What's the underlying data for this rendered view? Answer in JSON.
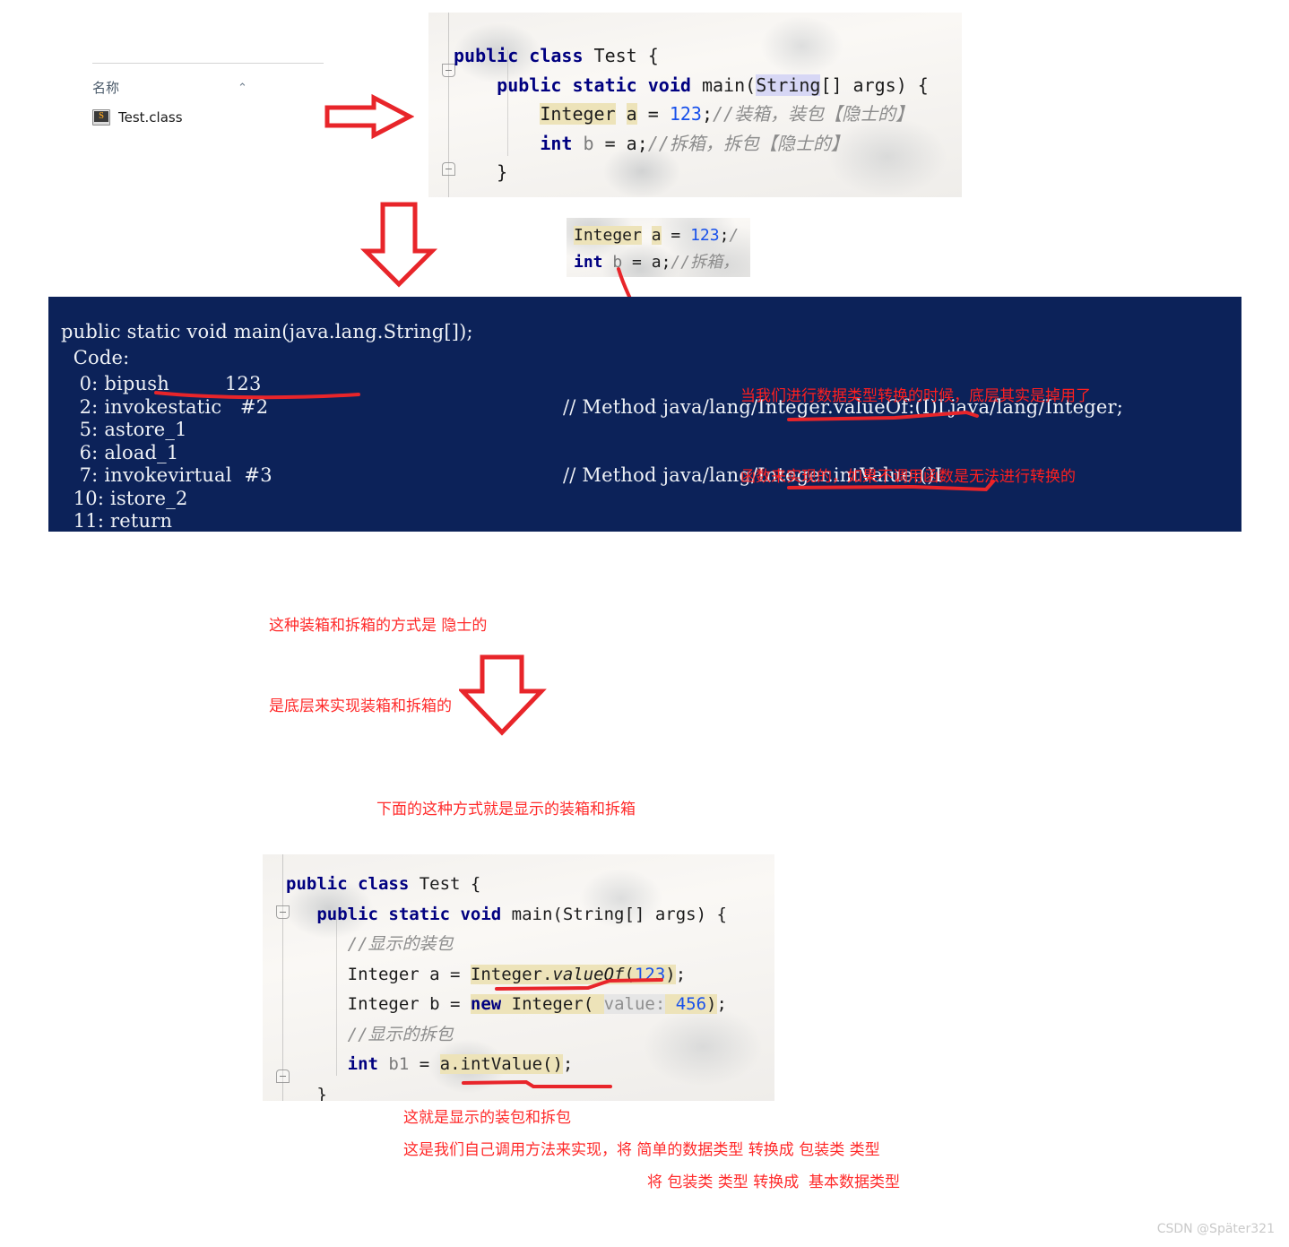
{
  "explorer": {
    "column_header": "名称",
    "sort_caret": "⌃",
    "file_name": "Test.class",
    "file_icon": "java-class-file-icon"
  },
  "top_editor": {
    "lines": [
      {
        "tokens": [
          {
            "t": "public ",
            "c": "kw"
          },
          {
            "t": "class ",
            "c": "kw"
          },
          {
            "t": "Test {",
            "c": "plain"
          }
        ]
      },
      {
        "tokens": [
          {
            "t": "    public ",
            "c": "kw"
          },
          {
            "t": "static ",
            "c": "kw"
          },
          {
            "t": "void ",
            "c": "kw"
          },
          {
            "t": "main(",
            "c": "plain"
          },
          {
            "t": "String",
            "c": "plain hlp"
          },
          {
            "t": "[] args) {",
            "c": "plain"
          }
        ]
      },
      {
        "tokens": [
          {
            "t": "        ",
            "c": "plain"
          },
          {
            "t": "Integer",
            "c": "plain hl"
          },
          {
            "t": " ",
            "c": "plain"
          },
          {
            "t": "a",
            "c": "plain hl"
          },
          {
            "t": " = ",
            "c": "plain"
          },
          {
            "t": "123",
            "c": "num"
          },
          {
            "t": ";",
            "c": "plain"
          },
          {
            "t": "//装箱，装包【隐士的】",
            "c": "cmt"
          }
        ]
      },
      {
        "tokens": [
          {
            "t": "        ",
            "c": "plain"
          },
          {
            "t": "int",
            "c": "kw"
          },
          {
            "t": " ",
            "c": "plain"
          },
          {
            "t": "b",
            "c": "var"
          },
          {
            "t": " = ",
            "c": "plain"
          },
          {
            "t": "a",
            "c": "plain"
          },
          {
            "t": ";",
            "c": "plain"
          },
          {
            "t": "//拆箱，拆包【隐士的】",
            "c": "cmt"
          }
        ]
      },
      {
        "tokens": [
          {
            "t": "    }",
            "c": "plain"
          }
        ]
      }
    ]
  },
  "snippet_editor": {
    "lines": [
      {
        "tokens": [
          {
            "t": "Integer",
            "c": "plain hl"
          },
          {
            "t": " ",
            "c": "plain"
          },
          {
            "t": "a",
            "c": "plain hl"
          },
          {
            "t": " = ",
            "c": "plain"
          },
          {
            "t": "123",
            "c": "num"
          },
          {
            "t": ";",
            "c": "plain"
          },
          {
            "t": "/",
            "c": "cmt"
          }
        ]
      },
      {
        "tokens": [
          {
            "t": "int",
            "c": "kw"
          },
          {
            "t": " ",
            "c": "plain"
          },
          {
            "t": "b",
            "c": "var"
          },
          {
            "t": " = ",
            "c": "plain"
          },
          {
            "t": "a",
            "c": "plain"
          },
          {
            "t": ";",
            "c": "plain"
          },
          {
            "t": "//拆箱，",
            "c": "cmt"
          }
        ]
      }
    ]
  },
  "bytecode": {
    "signature": "public static void main(java.lang.String[]);",
    "code_label": "  Code:",
    "instructions": [
      {
        "offset": "   0:",
        "op": "bipush",
        "operand": "123",
        "comment": ""
      },
      {
        "offset": "   2:",
        "op": "invokestatic",
        "operand": "#2",
        "comment": "// Method java/lang/Integer.valueOf:(I)Ljava/lang/Integer;"
      },
      {
        "offset": "   5:",
        "op": "astore_1",
        "operand": "",
        "comment": ""
      },
      {
        "offset": "   6:",
        "op": "aload_1",
        "operand": "",
        "comment": ""
      },
      {
        "offset": "   7:",
        "op": "invokevirtual",
        "operand": "#3",
        "comment": "// Method java/lang/Integer.intValue:()I"
      },
      {
        "offset": "  10:",
        "op": "istore_2",
        "operand": "",
        "comment": ""
      },
      {
        "offset": "  11:",
        "op": "return",
        "operand": "",
        "comment": ""
      }
    ]
  },
  "bottom_editor": {
    "lines": [
      {
        "tokens": [
          {
            "t": "public ",
            "c": "kw"
          },
          {
            "t": "class ",
            "c": "kw"
          },
          {
            "t": "Test {",
            "c": "plain"
          }
        ]
      },
      {
        "tokens": [
          {
            "t": "   public ",
            "c": "kw"
          },
          {
            "t": "static ",
            "c": "kw"
          },
          {
            "t": "void ",
            "c": "kw"
          },
          {
            "t": "main(String[] args) {",
            "c": "plain"
          }
        ]
      },
      {
        "tokens": [
          {
            "t": "      //显示的装包",
            "c": "cmt"
          }
        ]
      },
      {
        "tokens": [
          {
            "t": "      Integer a = ",
            "c": "plain"
          },
          {
            "t": "Integer.",
            "c": "plain hl"
          },
          {
            "t": "valueOf",
            "c": "plain hl ital"
          },
          {
            "t": "(",
            "c": "plain hl"
          },
          {
            "t": "123",
            "c": "num hl"
          },
          {
            "t": ")",
            "c": "plain hl"
          },
          {
            "t": ";",
            "c": "plain"
          }
        ]
      },
      {
        "tokens": [
          {
            "t": "      Integer b = ",
            "c": "plain"
          },
          {
            "t": "new",
            "c": "kw hl"
          },
          {
            "t": " Integer( ",
            "c": "plain hl"
          },
          {
            "t": "value:",
            "c": "param"
          },
          {
            "t": " ",
            "c": "plain hl"
          },
          {
            "t": "456",
            "c": "num hl"
          },
          {
            "t": ")",
            "c": "plain hl"
          },
          {
            "t": ";",
            "c": "plain"
          }
        ]
      },
      {
        "tokens": [
          {
            "t": "      //显示的拆包",
            "c": "cmt"
          }
        ]
      },
      {
        "tokens": [
          {
            "t": "      ",
            "c": "plain"
          },
          {
            "t": "int",
            "c": "kw"
          },
          {
            "t": " ",
            "c": "plain"
          },
          {
            "t": "b1",
            "c": "var"
          },
          {
            "t": " = ",
            "c": "plain"
          },
          {
            "t": "a.intValue()",
            "c": "plain hl"
          },
          {
            "t": ";",
            "c": "plain"
          }
        ]
      },
      {
        "tokens": [
          {
            "t": "   }",
            "c": "plain"
          }
        ]
      }
    ]
  },
  "annotations": {
    "bytecode_right": [
      "当我们进行数据类型转换的时候，底层其实是掉用了",
      "函数来实现的，如果不调用函数是无法进行转换的"
    ],
    "under_bytecode": [
      "这种装箱和拆箱的方式是 隐士的",
      "是底层来实现装箱和拆箱的"
    ],
    "middle": [
      "下面的这种方式就是显示的装箱和拆箱",
      "是我们自己调用方法来实现"
    ],
    "bottom_line1": "这就是显示的装包和拆包",
    "bottom_line2": "这是我们自己调用方法来实现，将 简单的数据类型 转换成 包装类 类型",
    "bottom_line3": "将 包装类 类型 转换成  基本数据类型"
  },
  "arrows": {
    "right_arrow": "arrow-right-icon",
    "down_arrow_1": "arrow-down-icon",
    "down_arrow_2": "arrow-down-icon",
    "curve_arrow": "curved-arrow-icon"
  },
  "colors": {
    "annotation_red": "#ff2a2a",
    "stroke_red": "#e8252a",
    "bytecode_bg": "#0c2259",
    "keyword_blue": "#000080",
    "number_blue": "#1750eb",
    "highlight_yellow": "#ede3b9"
  },
  "watermark": "CSDN @Später321"
}
